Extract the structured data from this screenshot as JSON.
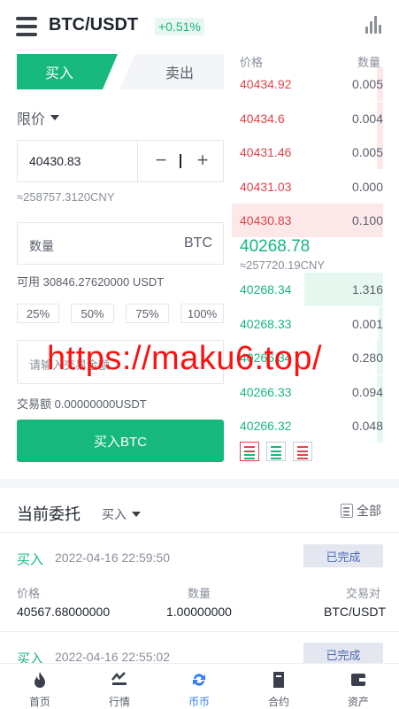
{
  "header": {
    "pair": "BTC/USDT",
    "change": "+0.51%"
  },
  "trade_tabs": {
    "buy": "买入",
    "sell": "卖出"
  },
  "order_type": "限价",
  "price_input": {
    "value": "40430.83",
    "cny": "≈258757.3120CNY"
  },
  "qty_input": {
    "placeholder": "数量",
    "unit": "BTC"
  },
  "available": "可用 30846.27620000 USDT",
  "percent_buttons": [
    "25%",
    "50%",
    "75%",
    "100%"
  ],
  "amount_input": {
    "placeholder": "请输入交易金额"
  },
  "trade_amount": "交易额 0.00000000USDT",
  "buy_button": "买入BTC",
  "orderbook": {
    "price_header": "价格",
    "qty_header": "数量",
    "asks": [
      {
        "price": "40434.92",
        "qty": "0.005",
        "depth": 0.04
      },
      {
        "price": "40434.6",
        "qty": "0.004",
        "depth": 0.04
      },
      {
        "price": "40431.46",
        "qty": "0.005",
        "depth": 0.04
      },
      {
        "price": "40431.03",
        "qty": "0.000",
        "depth": 0.0
      },
      {
        "price": "40430.83",
        "qty": "0.100",
        "depth": 1.0
      }
    ],
    "last_price": "40268.78",
    "last_cny": "≈257720.19CNY",
    "bids": [
      {
        "price": "40268.34",
        "qty": "1.316",
        "depth": 0.52
      },
      {
        "price": "40268.33",
        "qty": "0.001",
        "depth": 0.03
      },
      {
        "price": "40266.34",
        "qty": "0.280",
        "depth": 0.04
      },
      {
        "price": "40266.33",
        "qty": "0.094",
        "depth": 0.04
      },
      {
        "price": "40266.32",
        "qty": "0.048",
        "depth": 0.04
      }
    ]
  },
  "watermark": "https://maku6.top/",
  "orders": {
    "title": "当前委托",
    "filter": "买入",
    "all": "全部",
    "items": [
      {
        "side": "买入",
        "time": "2022-04-16 22:59:50",
        "status": "已完成",
        "price_label": "价格",
        "qty_label": "数量",
        "pair_label": "交易对",
        "price": "40567.68000000",
        "qty": "1.00000000",
        "pair": "BTC/USDT"
      },
      {
        "side": "买入",
        "time": "2022-04-16 22:55:02",
        "status": "已完成"
      }
    ]
  },
  "tabbar": [
    {
      "label": "首页",
      "icon": "flame-icon"
    },
    {
      "label": "行情",
      "icon": "market-icon"
    },
    {
      "label": "币币",
      "icon": "exchange-icon"
    },
    {
      "label": "合约",
      "icon": "contract-icon"
    },
    {
      "label": "资产",
      "icon": "wallet-icon"
    }
  ],
  "colors": {
    "green": "#16b87d",
    "red": "#e0434b",
    "active_tab": "#2f7cf6"
  }
}
